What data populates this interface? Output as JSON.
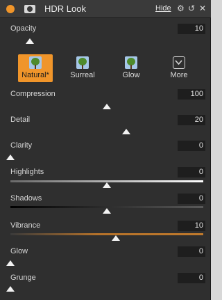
{
  "header": {
    "title": "HDR Look",
    "hide_label": "Hide",
    "icons": [
      "power-dot-icon",
      "camera-icon",
      "gear-icon",
      "reset-icon",
      "close-icon"
    ]
  },
  "presets": [
    {
      "label": "Natural*",
      "active": true
    },
    {
      "label": "Surreal",
      "active": false
    },
    {
      "label": "Glow",
      "active": false
    },
    {
      "label": "More",
      "active": false
    }
  ],
  "sliders": {
    "opacity": {
      "label": "Opacity",
      "value": "10"
    },
    "compression": {
      "label": "Compression",
      "value": "100"
    },
    "detail": {
      "label": "Detail",
      "value": "20"
    },
    "clarity": {
      "label": "Clarity",
      "value": "0"
    },
    "highlights": {
      "label": "Highlights",
      "value": "0"
    },
    "shadows": {
      "label": "Shadows",
      "value": "0"
    },
    "vibrance": {
      "label": "Vibrance",
      "value": "10"
    },
    "glow": {
      "label": "Glow",
      "value": "0"
    },
    "grunge": {
      "label": "Grunge",
      "value": "0"
    }
  },
  "colors": {
    "accent": "#f0952a",
    "panel": "#2f2f2f",
    "vibrance_track": "#b5722a"
  }
}
